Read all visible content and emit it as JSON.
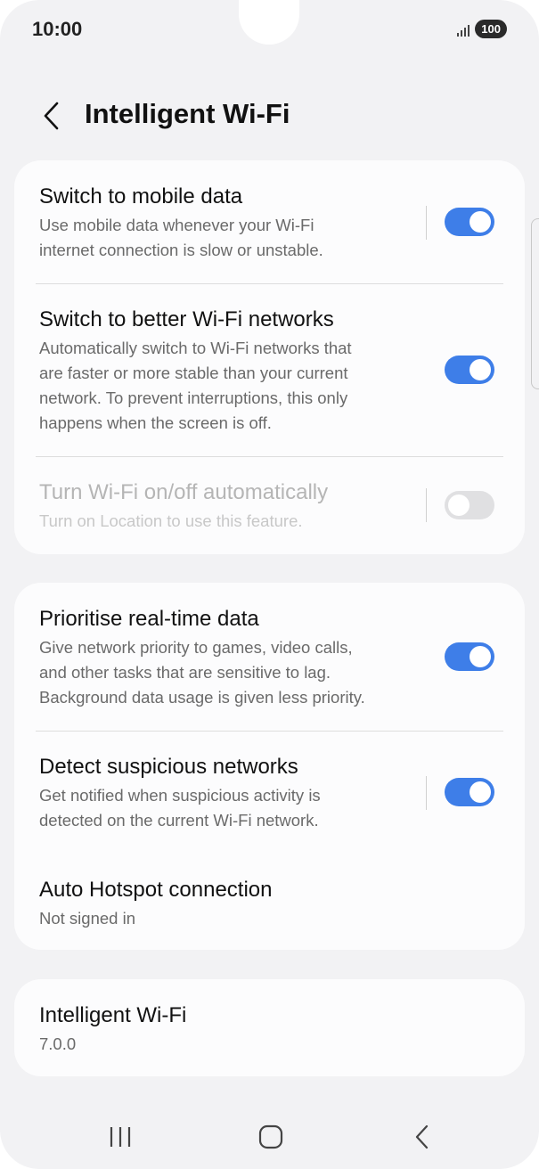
{
  "status_bar": {
    "time": "10:00",
    "battery": "100"
  },
  "header": {
    "title": "Intelligent Wi-Fi"
  },
  "group1": {
    "switch_mobile": {
      "title": "Switch to mobile data",
      "subtitle_lines": [
        "Use mobile data whenever your Wi-Fi",
        "internet connection is slow or unstable."
      ],
      "toggle": "on"
    },
    "better_wifi": {
      "title": "Switch to better Wi-Fi networks",
      "subtitle_lines": [
        "Automatically switch to Wi-Fi networks that",
        "are faster or more stable than your current",
        "network. To prevent interruptions, this only",
        "happens when the screen is off."
      ],
      "toggle": "on"
    },
    "auto_wifi": {
      "title": "Turn Wi-Fi on/off automatically",
      "subtitle_lines": [
        "Turn on Location to use this feature."
      ],
      "toggle": "off",
      "disabled": true
    }
  },
  "group2": {
    "realtime": {
      "title": "Prioritise real-time data",
      "subtitle_lines": [
        "Give network priority to games, video calls,",
        "and other tasks that are sensitive to lag.",
        "Background data usage is given less priority."
      ],
      "toggle": "on"
    },
    "suspicious": {
      "title": "Detect suspicious networks",
      "subtitle_lines": [
        "Get notified when suspicious activity is",
        "detected on the current Wi-Fi network."
      ],
      "toggle": "on"
    },
    "hotspot": {
      "title": "Auto Hotspot connection",
      "subtitle": "Not signed in"
    }
  },
  "about": {
    "title": "Intelligent Wi-Fi",
    "version": "7.0.0"
  },
  "colors": {
    "accent": "#3e7ee8",
    "background": "#f2f2f4",
    "card": "#fcfcfd"
  },
  "icons": {
    "back": "chevron-left-icon",
    "signal": "signal-icon",
    "recents": "recents-icon",
    "home": "home-icon",
    "nav_back": "nav-back-icon"
  }
}
